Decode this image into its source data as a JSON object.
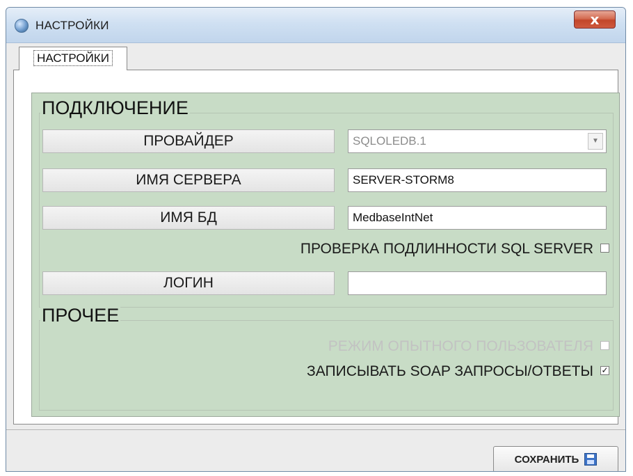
{
  "window": {
    "title": "НАСТРОЙКИ",
    "close_glyph": "x"
  },
  "tabs": [
    {
      "label": "НАСТРОЙКИ"
    }
  ],
  "connection": {
    "group_title": "ПОДКЛЮЧЕНИЕ",
    "provider": {
      "label": "ПРОВАЙДЕР",
      "value": "SQLOLEDB.1"
    },
    "server_name": {
      "label": "ИМЯ СЕРВЕРА",
      "value": "SERVER-STORM8"
    },
    "db_name": {
      "label": "ИМЯ БД",
      "value": "MedbaseIntNet"
    },
    "sql_auth": {
      "label": "ПРОВЕРКА ПОДЛИННОСТИ SQL SERVER",
      "checked": false
    },
    "login": {
      "label": "ЛОГИН",
      "value": ""
    }
  },
  "other": {
    "group_title": "ПРОЧЕЕ",
    "expert_mode": {
      "label": "РЕЖИМ ОПЫТНОГО ПОЛЬЗОВАТЕЛЯ",
      "checked": false,
      "enabled": false
    },
    "log_soap": {
      "label": "ЗАПИСЫВАТЬ SOAP ЗАПРОСЫ/ОТВЕТЫ",
      "checked": true,
      "check_glyph": "✓"
    }
  },
  "footer": {
    "save_label": "СОХРАНИТЬ",
    "save_icon": "floppy-disk-icon"
  },
  "colors": {
    "panel_green": "#c8dcc6",
    "close_red": "#c2452a",
    "accent_blue": "#3d73c7"
  }
}
